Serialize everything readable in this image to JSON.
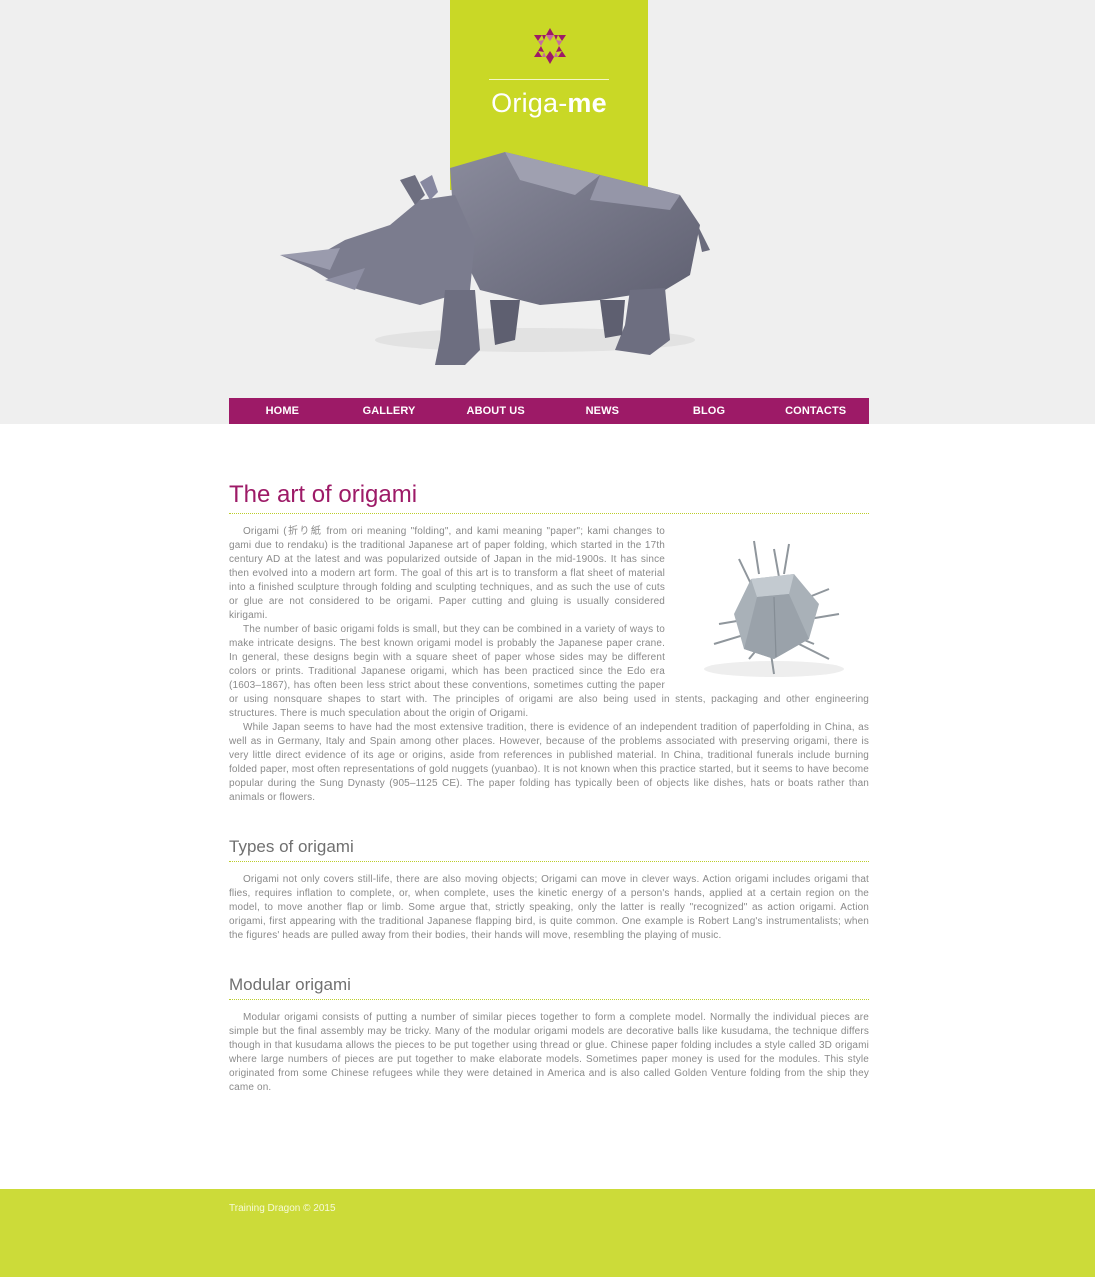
{
  "brand": {
    "name_prefix": "Origa-",
    "name_suffix": "me",
    "logo_icon": "star-of-triangles-icon",
    "colors": {
      "accent": "#c9d826",
      "primary": "#9d1a67",
      "footer": "#ccdb39",
      "header_bg": "#efefef"
    }
  },
  "nav": {
    "items": [
      {
        "label": "HOME"
      },
      {
        "label": "GALLERY"
      },
      {
        "label": "ABOUT US"
      },
      {
        "label": "NEWS"
      },
      {
        "label": "BLOG"
      },
      {
        "label": "CONTACTS"
      }
    ]
  },
  "hero": {
    "image": "origami-rhino"
  },
  "article": {
    "title": "The art of origami",
    "image": "origami-beetle",
    "paragraphs": [
      "Origami (折り紙 from ori meaning \"folding\", and kami meaning \"paper\"; kami changes to gami due to rendaku) is the traditional Japanese art of paper folding, which started in the 17th century AD at the latest and was popularized outside of Japan in the mid-1900s. It has since then evolved into a modern art form. The goal of this art is to transform a flat sheet of material into a finished sculpture through folding and sculpting techniques, and as such the use of cuts or glue are not considered to be origami. Paper cutting and gluing is usually considered kirigami.",
      "The number of basic origami folds is small, but they can be combined in a variety of ways to make intricate designs. The best known origami model is probably the Japanese paper crane. In general, these designs begin with a square sheet of paper whose sides may be different colors or prints. Traditional Japanese origami, which has been practiced since the Edo era (1603–1867), has often been less strict about these conventions, sometimes cutting the paper or using nonsquare shapes to start with. The principles of origami are also being used in stents, packaging and other engineering structures. There is much speculation about the origin of Origami.",
      "While Japan seems to have had the most extensive tradition, there is evidence of an independent tradition of paperfolding in China, as well as in Germany, Italy and Spain among other places. However, because of the problems associated with preserving origami, there is very little direct evidence of its age or origins, aside from references in published material. In China, traditional funerals include burning folded paper, most often representations of gold nuggets (yuanbao). It is not known when this practice started, but it seems to have become popular during the Sung Dynasty (905–1125 CE). The paper folding has typically been of objects like dishes, hats or boats rather than animals or flowers."
    ]
  },
  "types": {
    "title": "Types of origami",
    "paragraph": "Origami not only covers still-life, there are also moving objects; Origami can move in clever ways. Action origami includes origami that flies, requires inflation to complete, or, when complete, uses the kinetic energy of a person's hands, applied at a certain region on the model, to move another flap or limb. Some argue that, strictly speaking, only the latter is really \"recognized\" as action origami. Action origami, first appearing with the traditional Japanese flapping bird, is quite common. One example is Robert Lang's instrumentalists; when the figures' heads are pulled away from their bodies, their hands will move, resembling the playing of music."
  },
  "modular": {
    "title": "Modular origami",
    "paragraph": "Modular origami consists of putting a number of similar pieces together to form a complete model. Normally the individual pieces are simple but the final assembly may be tricky. Many of the modular origami models are decorative balls like kusudama, the technique differs though in that kusudama allows the pieces to be put together using thread or glue. Chinese paper folding includes a style called 3D origami where large numbers of pieces are put together to make elaborate models. Sometimes paper money is used for the modules. This style originated from some Chinese refugees while they were detained in America and is also called Golden Venture folding from the ship they came on."
  },
  "footer": {
    "copyright": "Training Dragon © 2015"
  }
}
